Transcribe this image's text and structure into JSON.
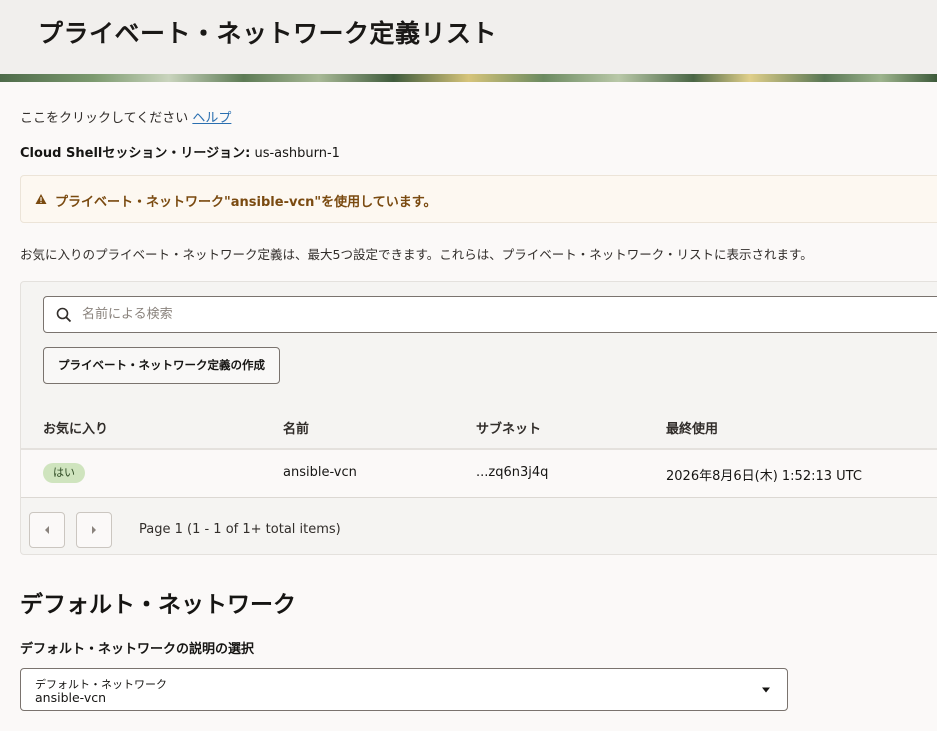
{
  "header": {
    "title": "プライベート・ネットワーク定義リスト"
  },
  "help": {
    "prefix": "ここをクリックしてください",
    "link_label": "ヘルプ"
  },
  "region": {
    "label": "Cloud Shellセッション・リージョン:",
    "value": "us-ashburn-1"
  },
  "warning": {
    "icon": "warning-triangle-icon",
    "message": "プライベート・ネットワーク\"ansible-vcn\"を使用しています。"
  },
  "description": "お気に入りのプライベート・ネットワーク定義は、最大5つ設定できます。これらは、プライベート・ネットワーク・リストに表示されます。",
  "search": {
    "placeholder": "名前による検索",
    "value": ""
  },
  "create_button_label": "プライベート・ネットワーク定義の作成",
  "table": {
    "columns": [
      "お気に入り",
      "名前",
      "サブネット",
      "最終使用"
    ],
    "rows": [
      {
        "favorite": "はい",
        "name": "ansible-vcn",
        "subnet": "...zq6n3j4q",
        "last_used": "2026年8月6日(木) 1:52:13 UTC"
      }
    ]
  },
  "pagination": {
    "text": "Page 1 (1 - 1 of 1+ total items)"
  },
  "default_network": {
    "section_title": "デフォルト・ネットワーク",
    "select_label": "デフォルト・ネットワークの説明の選択",
    "select_float_label": "デフォルト・ネットワーク",
    "select_value": "ansible-vcn"
  },
  "colors": {
    "link": "#2a6fb0",
    "warning_text": "#7a4a10",
    "badge_bg": "#cfe4be"
  }
}
